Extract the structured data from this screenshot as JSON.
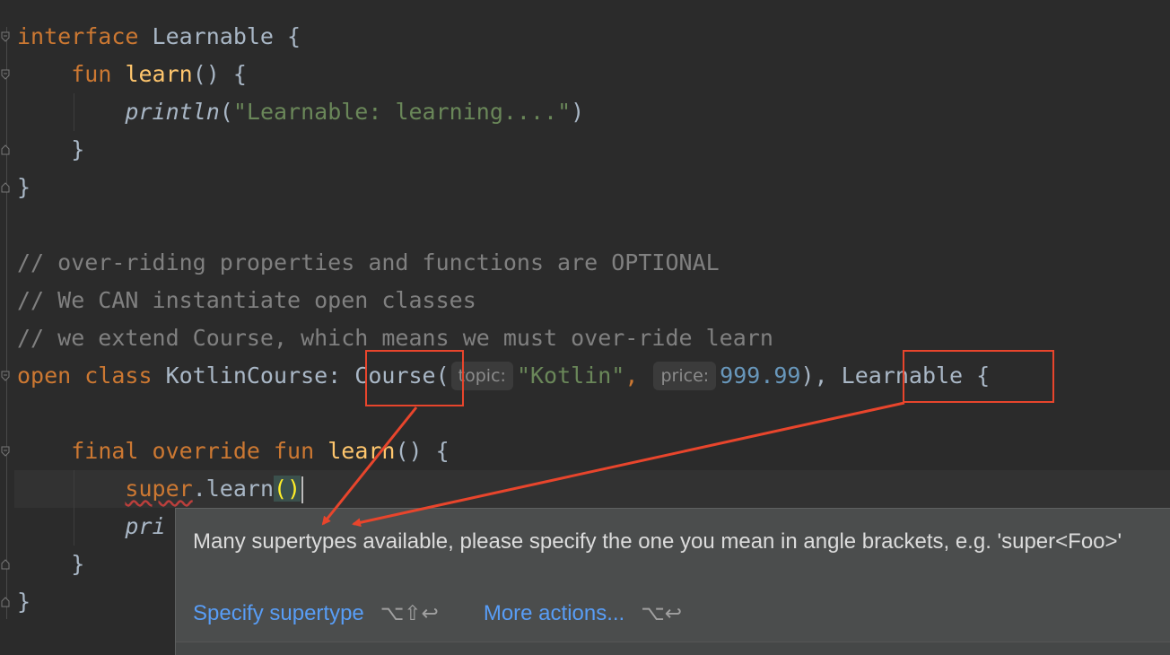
{
  "code": {
    "l1": {
      "kw": "interface",
      "name": " Learnable {"
    },
    "l2": {
      "indent": "    ",
      "kw": "fun",
      "sp": " ",
      "fn": "learn",
      "rest": "() {"
    },
    "l3": {
      "indent": "        ",
      "call": "println",
      "open": "(",
      "str": "\"Learnable: learning....\"",
      "close": ")"
    },
    "l4": {
      "text": "    }"
    },
    "l5": {
      "text": "}"
    },
    "l6": {
      "text": "// over-riding properties and functions are OPTIONAL"
    },
    "l7": {
      "text": "// We CAN instantiate open classes"
    },
    "l8": {
      "text": "// we extend Course, which means we must over-ride learn"
    },
    "l9": {
      "kw": "open class",
      "name": " KotlinCourse: ",
      "course": "Course",
      "paren": "(",
      "hint_topic": "topic:",
      "str_topic": "\"Kotlin\"",
      "comma1": ", ",
      "hint_price": "price:",
      "num_price": "999.99",
      "close": "), ",
      "learnable": "Learnable",
      "brace": " {"
    },
    "l10": {
      "indent": "    ",
      "kw": "final override fun",
      "sp": " ",
      "fn": "learn",
      "rest": "() {"
    },
    "l11": {
      "indent": "        ",
      "kw": "super",
      "dot": ".learn",
      "parens": "()"
    },
    "l12": {
      "indent": "        ",
      "text": "pri"
    },
    "l13": {
      "text": "    }"
    },
    "l14": {
      "text": "}"
    }
  },
  "popup": {
    "message": "Many supertypes available, please specify the one you mean in angle brackets, e.g. 'super<Foo>'",
    "action_primary": "Specify supertype",
    "action_primary_shortcut": "⌥⇧↩",
    "action_more": "More actions...",
    "action_more_shortcut": "⌥↩"
  },
  "colors": {
    "annotation": "#e8452c",
    "link": "#589df6",
    "keyword": "#cc7832",
    "function": "#ffc66d",
    "string": "#6a8759",
    "number": "#6897bb",
    "comment": "#808080"
  }
}
